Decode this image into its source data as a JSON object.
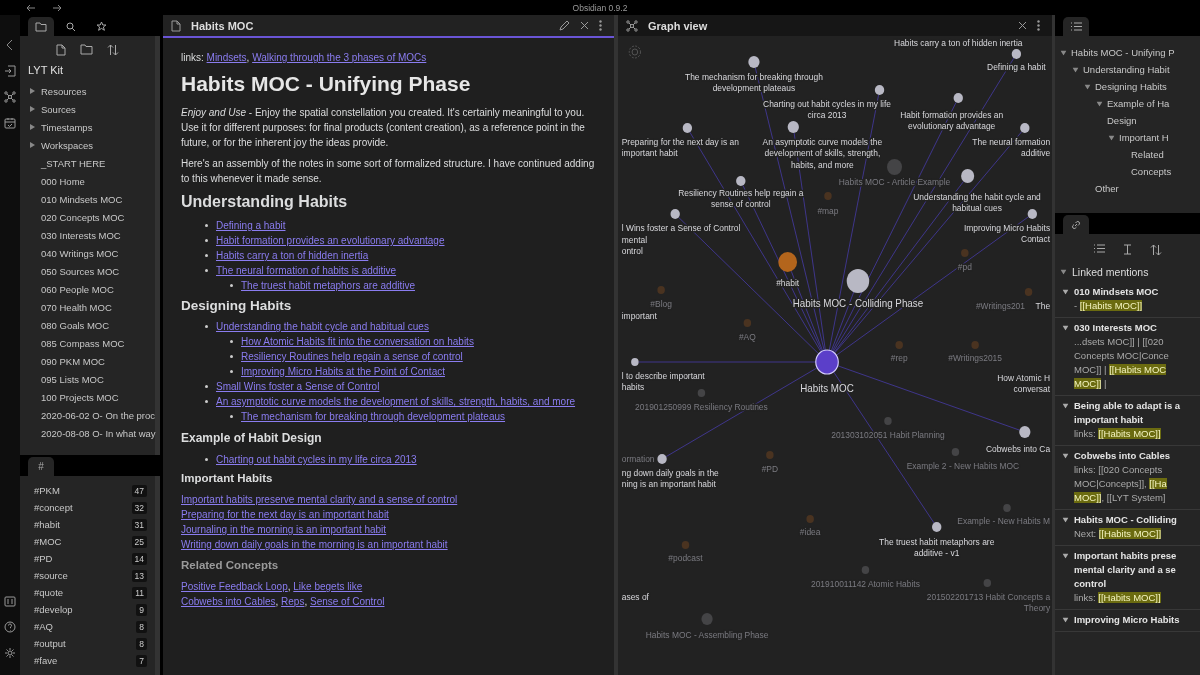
{
  "title_bar": {
    "title": "Obsidian 0.9.2"
  },
  "file_explorer": {
    "tabs": [
      {
        "selected": true
      },
      {
        "selected": false
      },
      {
        "selected": false
      }
    ],
    "vault": "LYT Kit",
    "items": [
      {
        "name": "Resources",
        "kind": "folder",
        "expanded": false
      },
      {
        "name": "Sources",
        "kind": "folder",
        "expanded": false
      },
      {
        "name": "Timestamps",
        "kind": "folder",
        "expanded": false
      },
      {
        "name": "Workspaces",
        "kind": "folder",
        "expanded": false
      },
      {
        "name": "_START HERE",
        "kind": "file"
      },
      {
        "name": "000 Home",
        "kind": "file"
      },
      {
        "name": "010 Mindsets MOC",
        "kind": "file"
      },
      {
        "name": "020 Concepts MOC",
        "kind": "file"
      },
      {
        "name": "030 Interests MOC",
        "kind": "file"
      },
      {
        "name": "040 Writings MOC",
        "kind": "file"
      },
      {
        "name": "050 Sources MOC",
        "kind": "file"
      },
      {
        "name": "060 People MOC",
        "kind": "file"
      },
      {
        "name": "070 Health MOC",
        "kind": "file"
      },
      {
        "name": "080 Goals MOC",
        "kind": "file"
      },
      {
        "name": "085 Compass MOC",
        "kind": "file"
      },
      {
        "name": "090 PKM MOC",
        "kind": "file"
      },
      {
        "name": "095 Lists MOC",
        "kind": "file"
      },
      {
        "name": "100 Projects MOC",
        "kind": "file"
      },
      {
        "name": "2020-06-02 O- On the proc",
        "kind": "file"
      },
      {
        "name": "2020-08-08 O- In what way",
        "kind": "file"
      }
    ]
  },
  "tags_pane": {
    "tab": "#",
    "tags": [
      {
        "name": "#PKM",
        "count": "47"
      },
      {
        "name": "#concept",
        "count": "32"
      },
      {
        "name": "#habit",
        "count": "31"
      },
      {
        "name": "#MOC",
        "count": "25"
      },
      {
        "name": "#PD",
        "count": "14"
      },
      {
        "name": "#source",
        "count": "13"
      },
      {
        "name": "#quote",
        "count": "11"
      },
      {
        "name": "#develop",
        "count": "9"
      },
      {
        "name": "#AQ",
        "count": "8"
      },
      {
        "name": "#output",
        "count": "8"
      },
      {
        "name": "#fave",
        "count": "7"
      }
    ]
  },
  "editor": {
    "title": "Habits MOC",
    "active": true,
    "blocks": [
      {
        "kind": "segments",
        "lines": [
          [
            {
              "text": "links: ",
              "link": false
            },
            {
              "text": "Mindsets",
              "link": true
            },
            {
              "text": ", ",
              "link": false
            },
            {
              "text": "Walking through the 3 phases of MOCs",
              "link": true
            }
          ]
        ]
      },
      {
        "kind": "h1",
        "text": "Habits MOC - Unifying Phase"
      },
      {
        "kind": "paragraph",
        "text": "*Enjoy and Use* - Enjoy the spatial constellation you created. It's certainly meaningful to you. Use it for different purposes: for final products (content creation), as a reference point in the future, or for the inherent joy the ideas provide."
      },
      {
        "kind": "paragraph",
        "text": "Here's an assembly of the notes in some sort of formalized structure. I have continued adding to this whenever it made sense."
      },
      {
        "kind": "h2",
        "text": "Understanding Habits"
      },
      {
        "kind": "list",
        "items": [
          {
            "text": "Defining a habit"
          },
          {
            "text": "Habit formation provides an evolutionary advantage"
          },
          {
            "text": "Habits carry a ton of hidden inertia"
          },
          {
            "text": "The neural formation of habits is additive",
            "children": [
              {
                "text": "The truest habit metaphors are additive"
              }
            ]
          }
        ]
      },
      {
        "kind": "h3",
        "text": "Designing Habits"
      },
      {
        "kind": "list",
        "items": [
          {
            "text": "Understanding the habit cycle and habitual cues",
            "children": [
              {
                "text": "How Atomic Habits fit into the conversation on habits"
              },
              {
                "text": "Resiliency Routines help regain a sense of control"
              },
              {
                "text": "Improving Micro Habits at the Point of Contact"
              }
            ]
          },
          {
            "text": "Small Wins foster a Sense of Control"
          },
          {
            "text": "An asymptotic curve models the development of skills, strength, habits, and more",
            "children": [
              {
                "text": "The mechanism for breaking through development plateaus"
              }
            ]
          }
        ]
      },
      {
        "kind": "h4",
        "text": "Example of Habit Design"
      },
      {
        "kind": "list",
        "items": [
          {
            "text": "Charting out habit cycles in my life circa 2013"
          }
        ]
      },
      {
        "kind": "h5",
        "text": "Important Habits"
      },
      {
        "kind": "segments",
        "lines": [
          [
            {
              "text": "Important habits preserve mental clarity and a sense of control",
              "link": true
            }
          ],
          [
            {
              "text": "Preparing for the next day is an important habit",
              "link": true
            }
          ],
          [
            {
              "text": "Journaling in the morning is an important habit",
              "link": true
            }
          ],
          [
            {
              "text": "Writing down daily goals in the morning is an important habit",
              "link": true
            }
          ]
        ]
      },
      {
        "kind": "h6",
        "text": "Related Concepts"
      },
      {
        "kind": "segments",
        "lines": [
          [
            {
              "text": "Positive Feedback Loop",
              "link": true
            },
            {
              "text": ", ",
              "link": false
            },
            {
              "text": "Like begets like",
              "link": true
            }
          ],
          [
            {
              "text": "Cobwebs into Cables",
              "link": true
            },
            {
              "text": ", ",
              "link": false
            },
            {
              "text": "Reps",
              "link": true
            },
            {
              "text": ", ",
              "link": false
            },
            {
              "text": "Sense of Control",
              "link": true
            }
          ]
        ]
      }
    ]
  },
  "graph": {
    "title": "Graph view",
    "nodes": [
      {
        "label": [
          "Habits carry a ton of hidden inertia"
        ],
        "kind": "label",
        "dimmed": false
      },
      {
        "label": [
          "Defining a habit"
        ],
        "kind": "note",
        "dimmed": false
      },
      {
        "label": [
          "The mechanism for breaking through",
          "development plateaus"
        ],
        "kind": "note",
        "dimmed": false
      },
      {
        "label": [
          "Charting out habit cycles in my life",
          "circa 2013"
        ],
        "kind": "note",
        "dimmed": false
      },
      {
        "label": [
          "Habit formation provides an",
          "evolutionary advantage"
        ],
        "kind": "note",
        "dimmed": false
      },
      {
        "label": [
          "Preparing for the next day is an",
          "important habit"
        ],
        "kind": "note",
        "dimmed": false
      },
      {
        "label": [
          "An asymptotic curve models the",
          "development of skills, strength,",
          "habits, and more"
        ],
        "kind": "note",
        "dimmed": false
      },
      {
        "label": [
          "The neural formation",
          "additive"
        ],
        "kind": "note",
        "dimmed": false
      },
      {
        "label": [
          "Habits MOC - Article Example"
        ],
        "kind": "note",
        "dimmed": true
      },
      {
        "label": [
          "Resiliency Routines help regain a",
          "sense of control"
        ],
        "kind": "note",
        "dimmed": false
      },
      {
        "label": [
          "Understanding the habit cycle and",
          "habitual cues"
        ],
        "kind": "note",
        "dimmed": false
      },
      {
        "label": [
          "#map"
        ],
        "kind": "tag",
        "dimmed": true
      },
      {
        "label": [
          "l Wins foster a Sense of Control"
        ],
        "kind": "note",
        "dimmed": false
      },
      {
        "label": [
          "mental",
          "ontrol"
        ],
        "kind": "label",
        "dimmed": false
      },
      {
        "label": [
          "Improving Micro Habits",
          "Contact"
        ],
        "kind": "note",
        "dimmed": false
      },
      {
        "label": [
          "#pd"
        ],
        "kind": "tag",
        "dimmed": true
      },
      {
        "label": [
          "#habit"
        ],
        "kind": "tag",
        "dimmed": false
      },
      {
        "label": [
          "#Blog"
        ],
        "kind": "tag",
        "dimmed": true
      },
      {
        "label": [
          "Habits MOC - Colliding Phase"
        ],
        "kind": "note",
        "dimmed": false
      },
      {
        "label": [
          "#Writings201"
        ],
        "kind": "tag",
        "dimmed": true
      },
      {
        "label": [
          "The"
        ],
        "kind": "label",
        "dimmed": false
      },
      {
        "label": [
          "important"
        ],
        "kind": "label",
        "dimmed": false
      },
      {
        "label": [
          "#AQ"
        ],
        "kind": "tag",
        "dimmed": true
      },
      {
        "label": [
          "Habits MOC"
        ],
        "kind": "current",
        "dimmed": false
      },
      {
        "label": [
          "#rep"
        ],
        "kind": "tag",
        "dimmed": true
      },
      {
        "label": [
          "#Writings2015"
        ],
        "kind": "tag",
        "dimmed": true
      },
      {
        "label": [
          "l to describe important",
          "habits"
        ],
        "kind": "note",
        "dimmed": false
      },
      {
        "label": [
          "How Atomic H",
          "conversat"
        ],
        "kind": "label",
        "dimmed": false
      },
      {
        "label": [
          "201901250999 Resiliency Routines"
        ],
        "kind": "note",
        "dimmed": true
      },
      {
        "label": [
          "201303102051 Habit Planning"
        ],
        "kind": "note",
        "dimmed": true
      },
      {
        "label": [
          "Cobwebs into Ca"
        ],
        "kind": "note",
        "dimmed": false
      },
      {
        "label": [
          "ormation"
        ],
        "kind": "label",
        "dimmed": true
      },
      {
        "label": [
          "ng down daily goals in the",
          "ning is an important habit"
        ],
        "kind": "note",
        "dimmed": false
      },
      {
        "label": [
          "#PD"
        ],
        "kind": "tag",
        "dimmed": true
      },
      {
        "label": [
          "Example 2 - New Habits MOC"
        ],
        "kind": "note",
        "dimmed": true
      },
      {
        "label": [
          "Example - New Habits M"
        ],
        "kind": "note",
        "dimmed": true
      },
      {
        "label": [
          "The truest habit metaphors are",
          "additive - v1"
        ],
        "kind": "note",
        "dimmed": false
      },
      {
        "label": [
          "#idea"
        ],
        "kind": "tag",
        "dimmed": true
      },
      {
        "label": [
          "#podcast"
        ],
        "kind": "tag",
        "dimmed": true
      },
      {
        "label": [
          "201910011142 Atomic Habits"
        ],
        "kind": "note",
        "dimmed": true
      },
      {
        "label": [
          "ases of"
        ],
        "kind": "label",
        "dimmed": false
      },
      {
        "label": [
          "201502201713 Habit Concepts a",
          "Theory"
        ],
        "kind": "note",
        "dimmed": true
      },
      {
        "label": [
          "Habits MOC - Assembling Phase"
        ],
        "kind": "note",
        "dimmed": true
      }
    ]
  },
  "outline": {
    "items": [
      {
        "lines": [
          "Habits MOC - Unifying P"
        ],
        "expanded": true,
        "children": [
          {
            "lines": [
              "Understanding Habit"
            ],
            "expanded": true,
            "children": [
              {
                "lines": [
                  "Designing Habits"
                ],
                "expanded": true,
                "children": [
                  {
                    "lines": [
                      "Example of Ha",
                      "Design"
                    ],
                    "expanded": true,
                    "children": [
                      {
                        "lines": [
                          "Important H"
                        ],
                        "expanded": true,
                        "children": [
                          {
                            "lines": [
                              "Related",
                              "Concepts"
                            ]
                          }
                        ]
                      }
                    ]
                  }
                ]
              },
              {
                "lines": [
                  "Other"
                ]
              }
            ]
          }
        ]
      }
    ]
  },
  "backlinks": {
    "heading": "Linked mentions",
    "expanded": true,
    "groups": [
      {
        "title": [
          "010 Mindsets MOC"
        ],
        "expanded": true,
        "lines": [
          [
            {
              "text": "- ",
              "highlight": false
            },
            {
              "text": "[[Habits MOC]]",
              "highlight": true
            }
          ]
        ]
      },
      {
        "title": [
          "030 Interests MOC"
        ],
        "expanded": true,
        "lines": [
          [
            {
              "text": "...dsets MOC]] | [[020",
              "highlight": false
            }
          ],
          [
            {
              "text": "Concepts MOC|Conce",
              "highlight": false
            }
          ],
          [
            {
              "text": "MOC]] | ",
              "highlight": false
            },
            {
              "text": "[[Habits MOC",
              "highlight": true
            }
          ],
          [
            {
              "text": "MOC]]",
              "highlight": true
            },
            {
              "text": " |",
              "highlight": false
            }
          ]
        ]
      },
      {
        "title": [
          "Being able to adapt is a",
          "important habit"
        ],
        "expanded": true,
        "lines": [
          [
            {
              "text": "links: ",
              "highlight": false
            },
            {
              "text": "[[Habits MOC]]",
              "highlight": true
            }
          ]
        ]
      },
      {
        "title": [
          "Cobwebs into Cables"
        ],
        "expanded": true,
        "lines": [
          [
            {
              "text": "links:  [[020 Concepts",
              "highlight": false
            }
          ],
          [
            {
              "text": "MOC|Concepts]], ",
              "highlight": false
            },
            {
              "text": "[[Ha",
              "highlight": true
            }
          ],
          [
            {
              "text": "MOC]]",
              "highlight": true
            },
            {
              "text": ", [[LYT System]",
              "highlight": false
            }
          ]
        ]
      },
      {
        "title": [
          "Habits MOC - Colliding"
        ],
        "expanded": true,
        "lines": [
          [
            {
              "text": "Next: ",
              "highlight": false
            },
            {
              "text": "[[Habits MOC]]",
              "highlight": true
            }
          ]
        ]
      },
      {
        "title": [
          "Important habits prese",
          "mental clarity and a se",
          "control"
        ],
        "expanded": true,
        "lines": [
          [
            {
              "text": "links: ",
              "highlight": false
            },
            {
              "text": "[[Habits MOC]]",
              "highlight": true
            }
          ]
        ]
      },
      {
        "title": [
          "Improving Micro Habits"
        ],
        "expanded": true
      }
    ]
  }
}
